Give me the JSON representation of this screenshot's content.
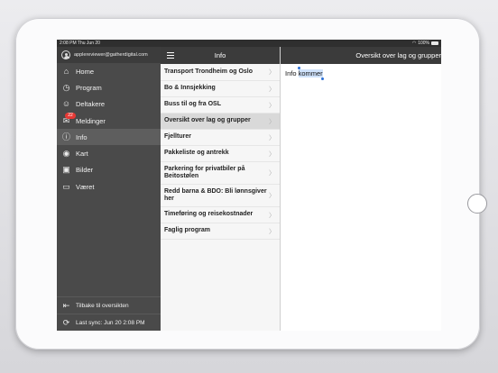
{
  "status_bar": {
    "time": "2:08 PM  Thu Jun 20",
    "battery": "100%"
  },
  "sidebar": {
    "account": "applereviewer@gatherdigital.com",
    "items": [
      {
        "label": "Home",
        "icon": "home-icon",
        "glyph": "⌂"
      },
      {
        "label": "Program",
        "icon": "clock-icon",
        "glyph": "◷"
      },
      {
        "label": "Deltakere",
        "icon": "people-icon",
        "glyph": "☺"
      },
      {
        "label": "Meldinger",
        "icon": "envelope-icon",
        "glyph": "✉",
        "badge": "22"
      },
      {
        "label": "Info",
        "icon": "info-icon",
        "glyph": "ⓘ",
        "active": true
      },
      {
        "label": "Kart",
        "icon": "map-pin-icon",
        "glyph": "◉"
      },
      {
        "label": "Bilder",
        "icon": "photo-icon",
        "glyph": "▣"
      },
      {
        "label": "Været",
        "icon": "weather-icon",
        "glyph": "▭"
      }
    ],
    "back_label": "Tilbake til oversikten",
    "sync_label": "Last sync:  Jun 20 2:08 PM"
  },
  "list": {
    "title": "Info",
    "items": [
      {
        "label": "Transport Trondheim og Oslo",
        "height": 19
      },
      {
        "label": "Bo & Innsjekking",
        "height": 18
      },
      {
        "label": "Buss til og fra OSL",
        "height": 18
      },
      {
        "label": "Oversikt over lag og grupper",
        "height": 18,
        "selected": true
      },
      {
        "label": "Fjellturer",
        "height": 18
      },
      {
        "label": "Pakkeliste og antrekk",
        "height": 18
      },
      {
        "label": "Parkering for privatbiler på Beitostølen",
        "height": 25
      },
      {
        "label": "Redd barna & BDO: Bli lønnsgiver her",
        "height": 25
      },
      {
        "label": "Timeføring og reisekostnader",
        "height": 18
      },
      {
        "label": "Faglig program",
        "height": 18
      }
    ]
  },
  "detail": {
    "title": "Oversikt over lag og grupper",
    "text_plain": "Info ",
    "text_selected": "kommer"
  }
}
